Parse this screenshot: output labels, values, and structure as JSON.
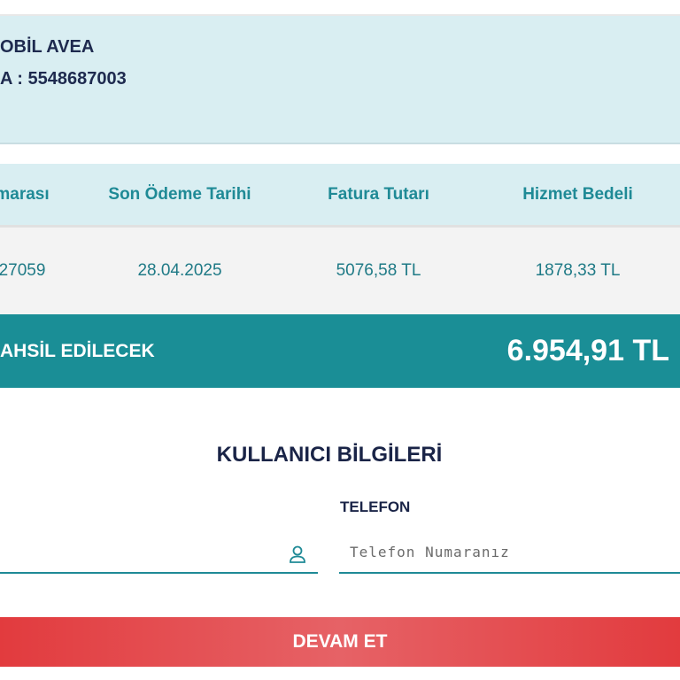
{
  "operator": {
    "name_line": "OBİL AVEA",
    "number_line": "A : 5548687003"
  },
  "bill_table": {
    "headers": [
      "marası",
      "Son Ödeme Tarihi",
      "Fatura Tutarı",
      "Hizmet Bedeli"
    ],
    "rows": [
      [
        "27059",
        "28.04.2025",
        "5076,58 TL",
        "1878,33 TL"
      ]
    ]
  },
  "total": {
    "label": "AHSİL EDİLECEK",
    "amount": "6.954,91 TL"
  },
  "user_info": {
    "title": "KULLANICI BİLGİLERİ",
    "phone_label": "TELEFON",
    "phone_placeholder": "Telefon Numaranız",
    "phone_value": ""
  },
  "actions": {
    "continue_label": "DEVAM ET"
  },
  "icons": {
    "name_field_icon": "user-icon"
  },
  "colors": {
    "teal": "#1a8e96",
    "light_teal_bg": "#d9eef2",
    "navy_text": "#1a2447",
    "red_button": "#e23b3e"
  }
}
